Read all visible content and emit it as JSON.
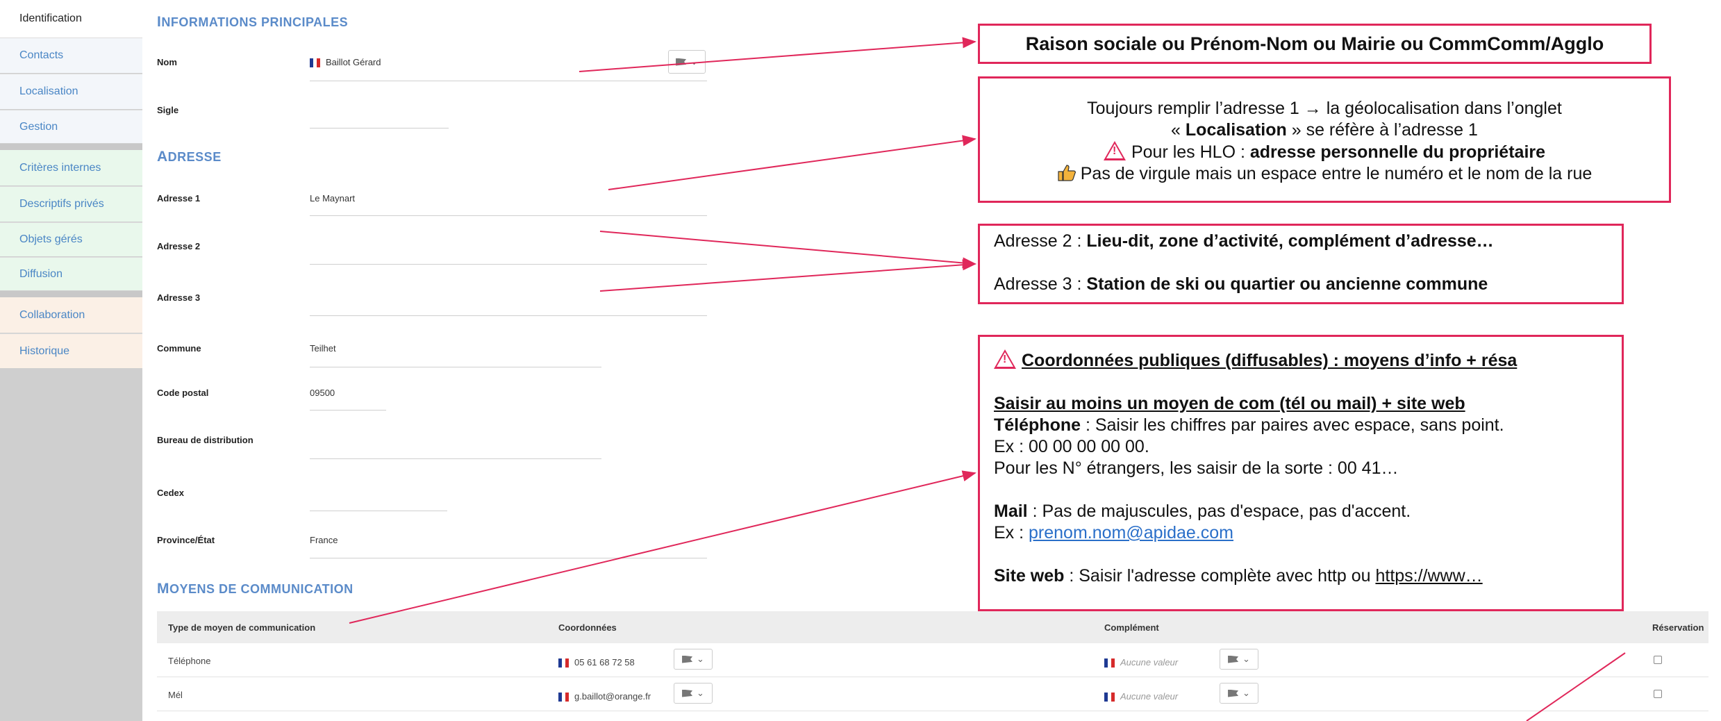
{
  "sidebar": {
    "items": [
      {
        "label": "Identification"
      },
      {
        "label": "Contacts"
      },
      {
        "label": "Localisation"
      },
      {
        "label": "Gestion"
      },
      {
        "label": "Critères internes"
      },
      {
        "label": "Descriptifs privés"
      },
      {
        "label": "Objets gérés"
      },
      {
        "label": "Diffusion"
      },
      {
        "label": "Collaboration"
      },
      {
        "label": "Historique"
      }
    ]
  },
  "sections": {
    "infos": {
      "first": "I",
      "rest": "NFORMATIONS PRINCIPALES"
    },
    "adresse": {
      "first": "A",
      "rest": "DRESSE"
    },
    "moyens": {
      "first": "M",
      "rest": "OYENS DE COMMUNICATION"
    }
  },
  "fields": {
    "nom": {
      "label": "Nom",
      "value": "Baillot Gérard"
    },
    "sigle": {
      "label": "Sigle",
      "value": ""
    },
    "adresse1": {
      "label": "Adresse 1",
      "value": "Le Maynart"
    },
    "adresse2": {
      "label": "Adresse 2",
      "value": ""
    },
    "adresse3": {
      "label": "Adresse 3",
      "value": ""
    },
    "commune": {
      "label": "Commune",
      "value": "Teilhet"
    },
    "code_postal": {
      "label": "Code postal",
      "value": "09500"
    },
    "bureau": {
      "label": "Bureau de distribution",
      "value": ""
    },
    "cedex": {
      "label": "Cedex",
      "value": ""
    },
    "province": {
      "label": "Province/État",
      "value": "France"
    }
  },
  "table": {
    "headers": {
      "type": "Type de moyen de communication",
      "coord": "Coordonnées",
      "complement": "Complément",
      "reservation": "Réservation"
    },
    "rows": [
      {
        "type": "Téléphone",
        "coord": "05 61 68 72 58",
        "complement": "Aucune valeur"
      },
      {
        "type": "Mél",
        "coord": "g.baillot@orange.fr",
        "complement": "Aucune valeur"
      }
    ]
  },
  "annotations": {
    "box1": "Raison sociale ou Prénom-Nom ou Mairie ou CommComm/Agglo",
    "box2": {
      "line1": "Toujours remplir l’adresse 1 → la géolocalisation dans l’onglet",
      "line2_pre": "« ",
      "line2_bold": "Localisation",
      "line2_post": " » se réfère à l’adresse 1",
      "line3_pre": "Pour les HLO : ",
      "line3_bold": "adresse personnelle du propriétaire",
      "line4": "Pas de virgule mais un espace entre le numéro et le nom de la rue"
    },
    "box3": {
      "a2_pre": "Adresse 2 : ",
      "a2_bold": "Lieu-dit, zone d’activité, complément d’adresse…",
      "a3_pre": "Adresse 3 : ",
      "a3_bold": "Station de ski ou quartier ou ancienne commune"
    },
    "box4": {
      "title": "Coordonnées publiques (diffusables) : moyens d’info + résa",
      "sub": "Saisir au moins un moyen de com (tél ou mail) + site web",
      "tel_bold": "Téléphone",
      "tel_text": " : Saisir les chiffres par paires avec espace, sans point.",
      "tel_ex": "Ex : 00 00 00 00 00.",
      "tel_foreign": "Pour les N° étrangers, les saisir de la sorte : 00 41…",
      "mail_bold": "Mail",
      "mail_text": " : Pas de majuscules, pas d'espace, pas d'accent.",
      "mail_ex_pre": "Ex : ",
      "mail_ex_link": "prenom.nom@apidae.com",
      "web_bold": "Site web",
      "web_text": " : Saisir l'adresse complète avec http ou ",
      "web_link": "https://www…"
    }
  },
  "colors": {
    "accent": "#e0275a",
    "section_title": "#5b8bc9",
    "link": "#4a86c5"
  }
}
